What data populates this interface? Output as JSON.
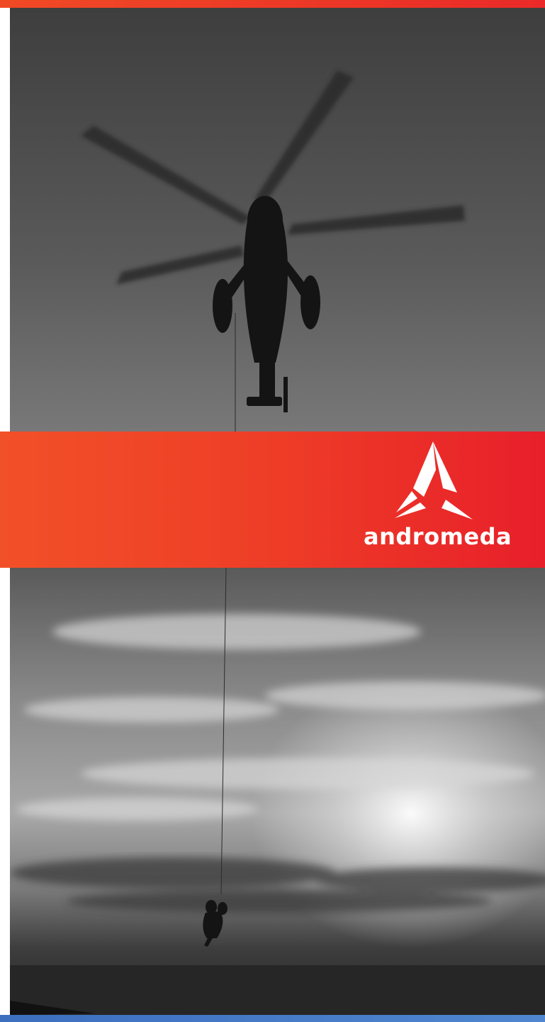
{
  "brand": {
    "name": "andromeda",
    "logo_icon": "andromeda-logo-icon",
    "colors": {
      "accent_red": "#ee3d27",
      "accent_orange": "#f25028",
      "footer_blue": "#4a7fc8"
    }
  },
  "images": {
    "top": "helicopter-silhouette-photo",
    "bottom": "winch-rescue-sunset-photo"
  }
}
